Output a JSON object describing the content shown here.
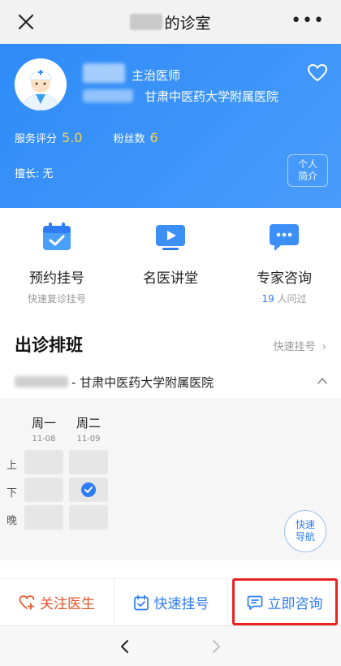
{
  "nav": {
    "title_suffix": "的诊室",
    "more": "•••"
  },
  "doctor": {
    "title": "主治医师",
    "hospital": "甘肃中医药大学附属医院",
    "rating_label": "服务评分",
    "rating_value": "5.0",
    "fans_label": "粉丝数",
    "fans_value": "6",
    "specialty": "擅长: 无",
    "intro_line1": "个人",
    "intro_line2": "简介"
  },
  "actions": [
    {
      "label": "预约挂号",
      "sub": "快速复诊挂号",
      "icon": "calendar-check-icon"
    },
    {
      "label": "名医讲堂",
      "sub": "",
      "icon": "video-play-icon"
    },
    {
      "label": "专家咨询",
      "sub_count": "19",
      "sub_suffix": " 人问过",
      "icon": "chat-bubble-icon"
    }
  ],
  "schedule": {
    "title": "出诊排班",
    "link": "快速挂号",
    "hospital_suffix": "- 甘肃中医药大学附属医院",
    "days": [
      {
        "day": "周一",
        "date": "11-08"
      },
      {
        "day": "周二",
        "date": "11-09"
      }
    ],
    "rows": [
      "上",
      "下",
      "晚"
    ],
    "quick_nav_line1": "快速",
    "quick_nav_line2": "导航"
  },
  "bottom": {
    "follow": "关注医生",
    "register": "快速挂号",
    "consult": "立即咨询"
  },
  "colors": {
    "primary_blue": "#2e7cf6",
    "hero_blue": "#3a93f8",
    "accent_yellow": "#ffd24a",
    "follow_orange": "#e8552b",
    "highlight_red": "#e8221f"
  }
}
